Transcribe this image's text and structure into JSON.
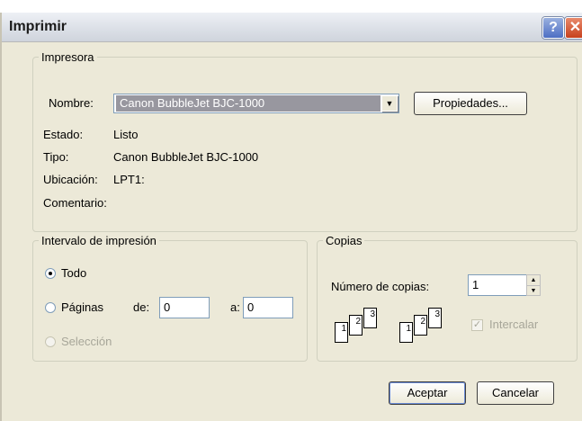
{
  "window": {
    "title": "Imprimir",
    "help_symbol": "?",
    "close_symbol": "✕"
  },
  "printer": {
    "group_label": "Impresora",
    "name_label": "Nombre:",
    "name_value": "Canon BubbleJet BJC-1000",
    "properties_button": "Propiedades...",
    "status_label": "Estado:",
    "status_value": "Listo",
    "type_label": "Tipo:",
    "type_value": "Canon BubbleJet BJC-1000",
    "location_label": "Ubicación:",
    "location_value": "LPT1:",
    "comment_label": "Comentario:"
  },
  "range": {
    "group_label": "Intervalo de impresión",
    "all_label": "Todo",
    "pages_label": "Páginas",
    "from_label": "de:",
    "from_value": "0",
    "to_label": "a:",
    "to_value": "0",
    "selection_label": "Selección",
    "selected": "Todo"
  },
  "copies": {
    "group_label": "Copias",
    "count_label": "Número de copias:",
    "count_value": "1",
    "collate_label": "Intercalar",
    "collate_checked": true,
    "collate_enabled": false,
    "page_numbers": [
      "1",
      "2",
      "3"
    ]
  },
  "buttons": {
    "ok": "Aceptar",
    "cancel": "Cancelar"
  }
}
